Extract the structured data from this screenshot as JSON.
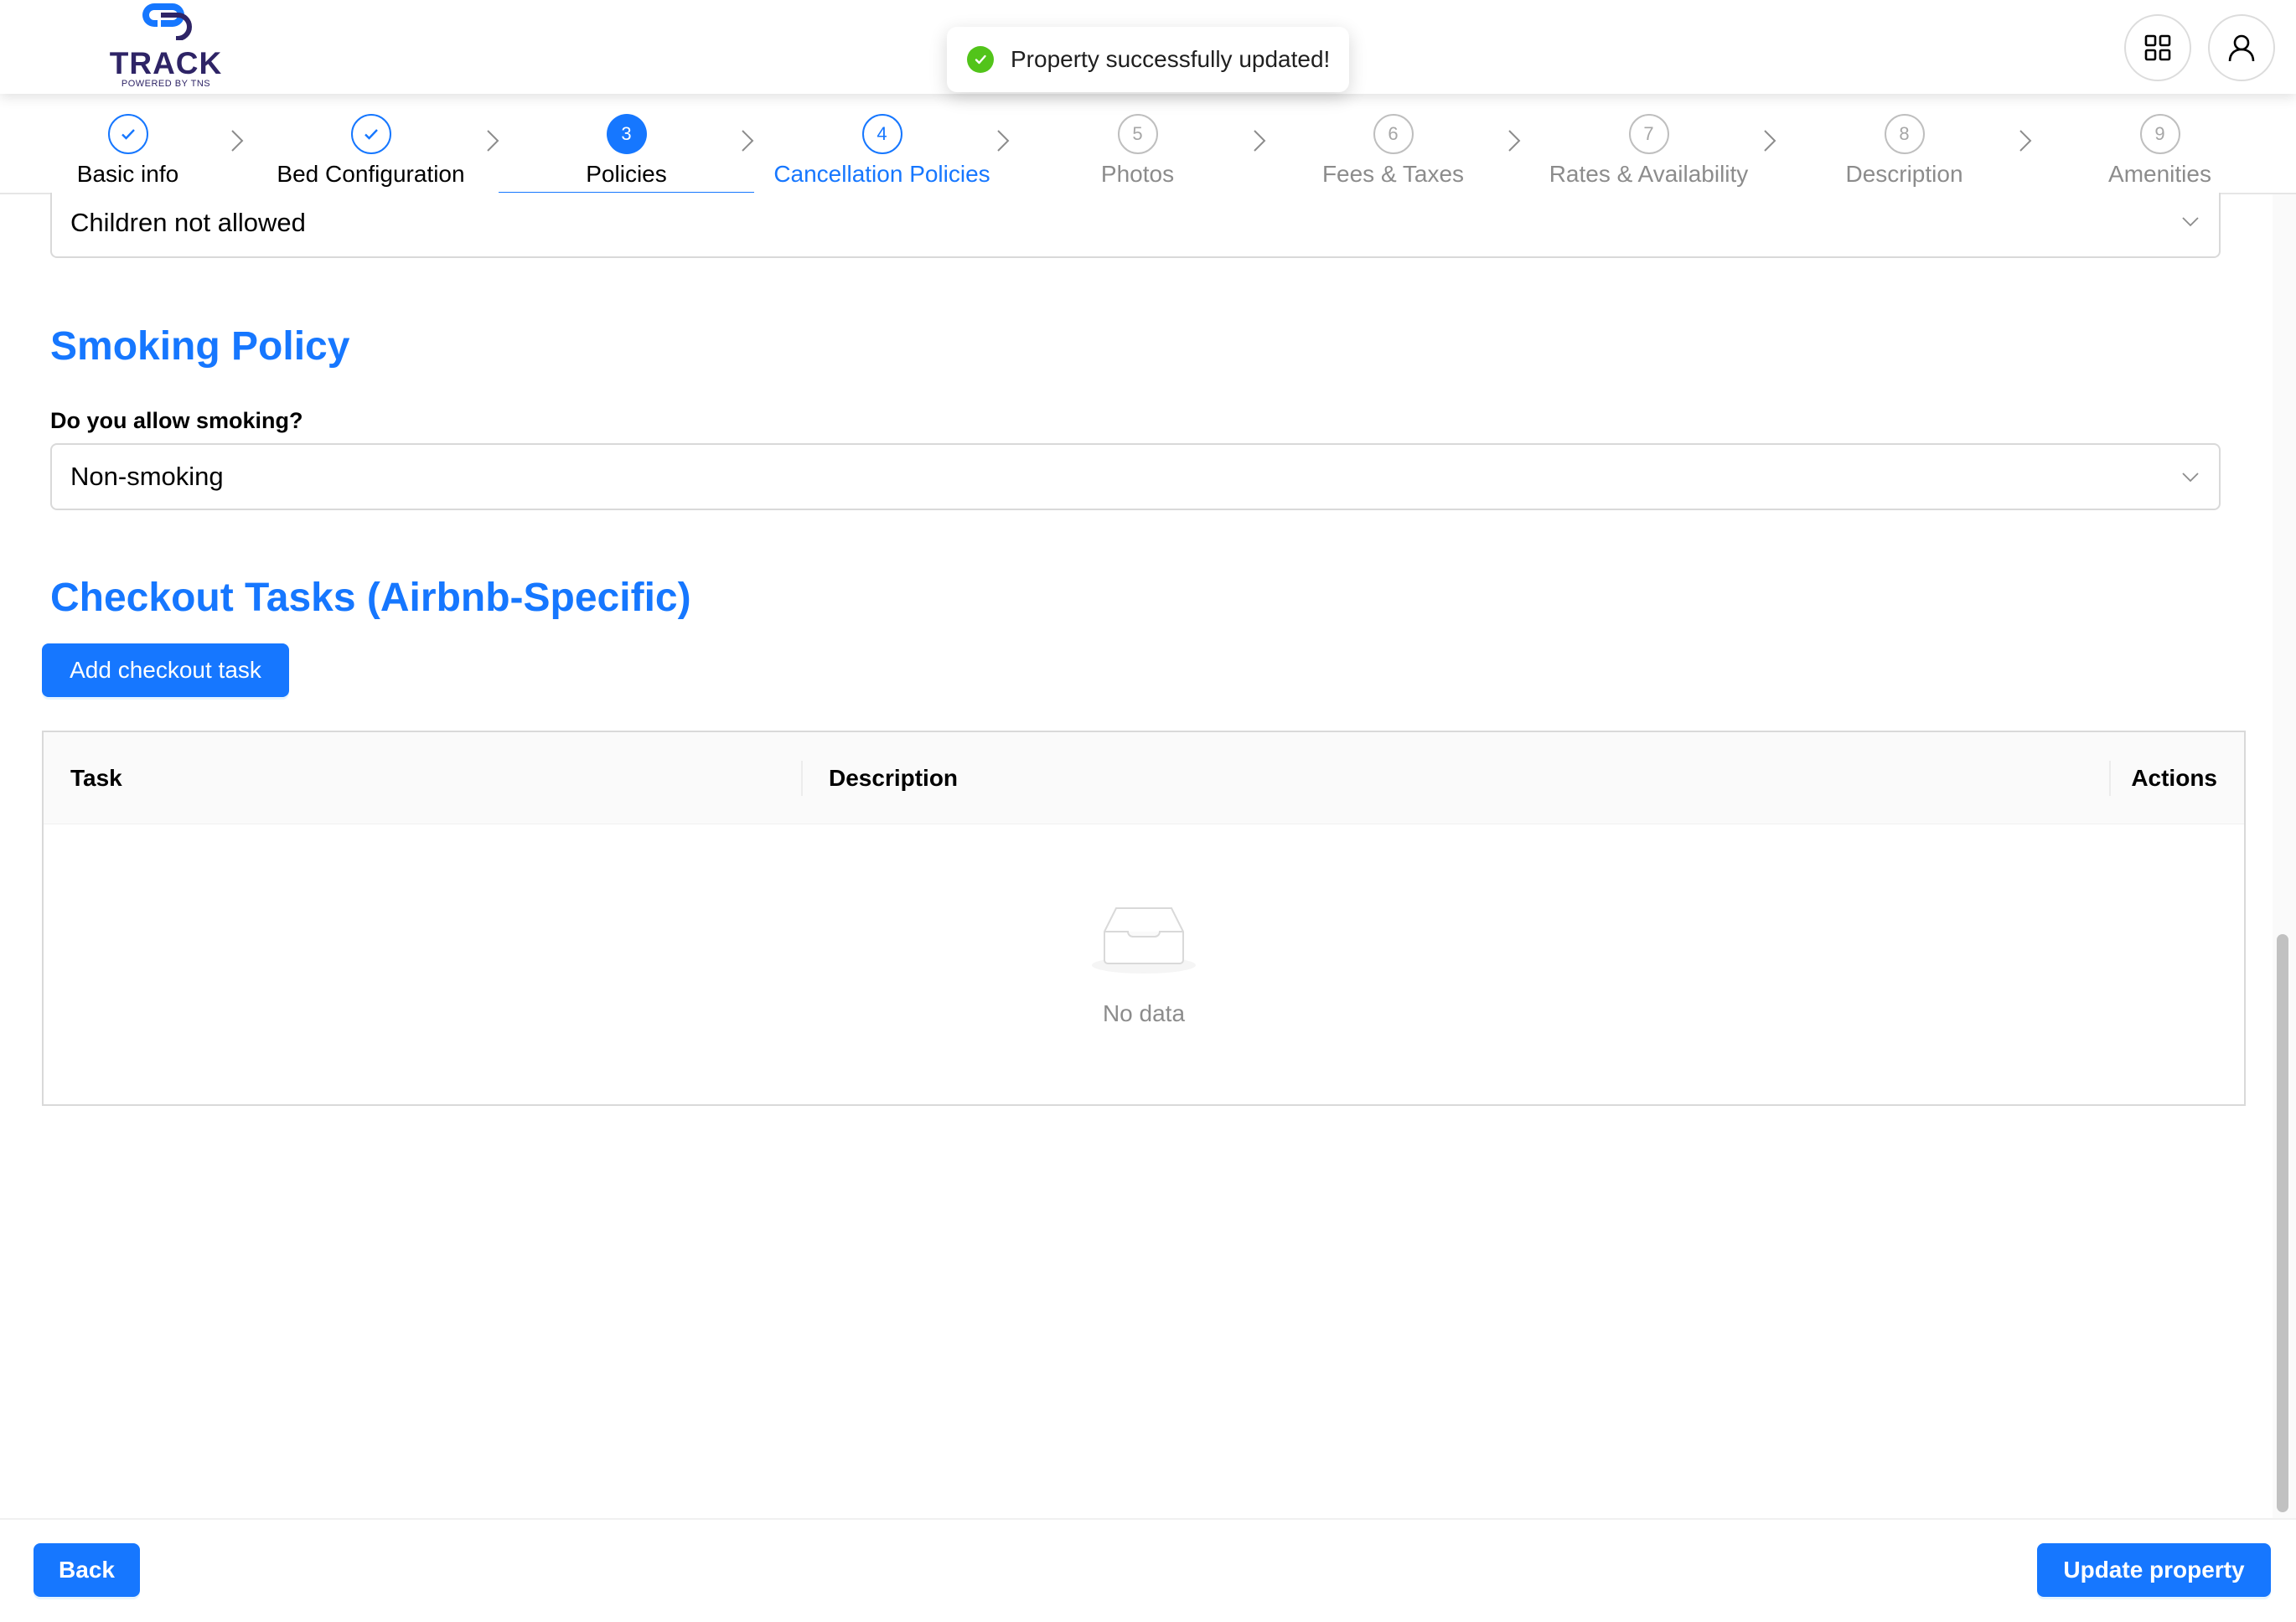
{
  "header": {
    "logo_text": "TRACK",
    "logo_sub": "POWERED BY TNS",
    "apps_icon": "grid-apps-icon",
    "user_icon": "user-icon"
  },
  "toast": {
    "message": "Property successfully updated!",
    "icon": "check-circle-icon",
    "color": "#52c41a"
  },
  "steps": [
    {
      "number": "1",
      "label": "Basic info",
      "status": "done"
    },
    {
      "number": "2",
      "label": "Bed Configuration",
      "status": "done"
    },
    {
      "number": "3",
      "label": "Policies",
      "status": "active"
    },
    {
      "number": "4",
      "label": "Cancellation Policies",
      "status": "hover"
    },
    {
      "number": "5",
      "label": "Photos",
      "status": "wait"
    },
    {
      "number": "6",
      "label": "Fees & Taxes",
      "status": "wait"
    },
    {
      "number": "7",
      "label": "Rates & Availability",
      "status": "wait"
    },
    {
      "number": "8",
      "label": "Description",
      "status": "wait"
    },
    {
      "number": "9",
      "label": "Amenities",
      "status": "wait"
    }
  ],
  "children_policy": {
    "value": "Children not allowed"
  },
  "smoking": {
    "title": "Smoking Policy",
    "question": "Do you allow smoking?",
    "value": "Non-smoking"
  },
  "checkout": {
    "title": "Checkout Tasks (Airbnb-Specific)",
    "add_button": "Add checkout task",
    "columns": [
      "Task",
      "Description",
      "Actions"
    ],
    "rows": [],
    "empty_text": "No data"
  },
  "footer": {
    "back_label": "Back",
    "update_label": "Update property"
  },
  "colors": {
    "primary": "#1677ff",
    "logo": "#2e2466",
    "success": "#52c41a"
  }
}
